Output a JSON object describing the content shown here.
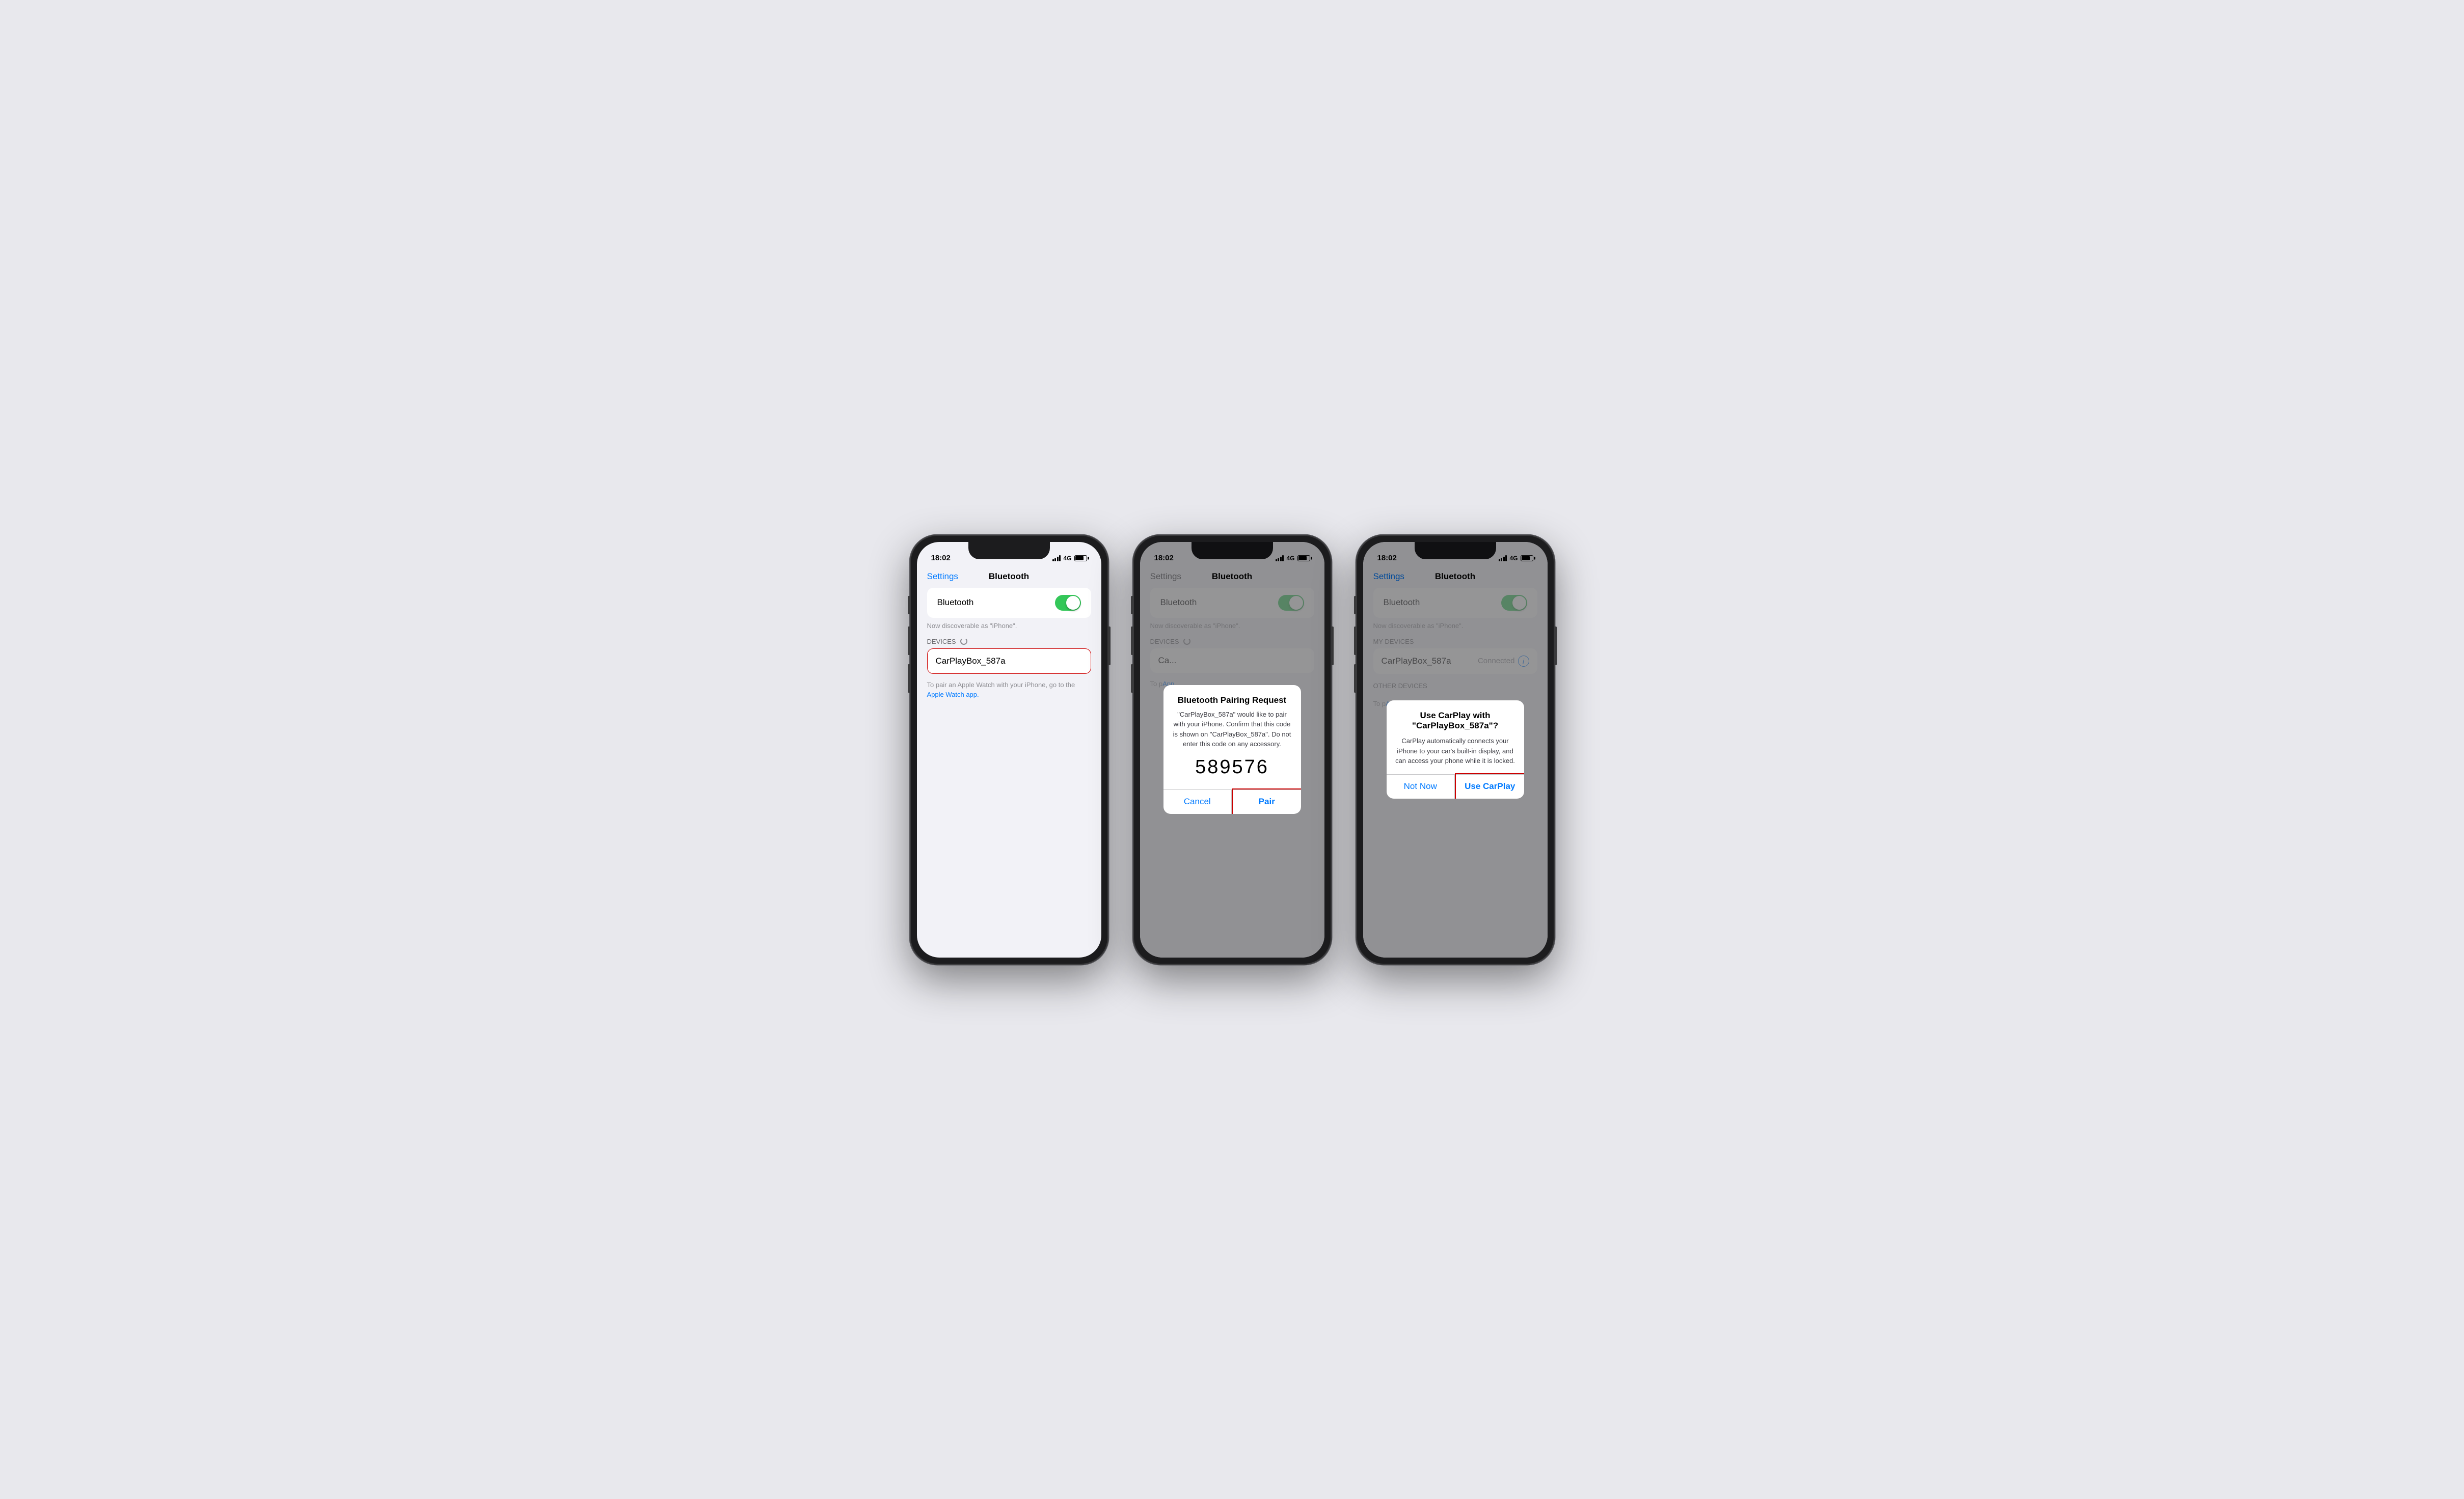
{
  "background_color": "#e8e8ed",
  "phones": [
    {
      "id": "phone1",
      "status_time": "18:02",
      "status_signal": "4G",
      "nav_back": "Settings",
      "nav_title": "Bluetooth",
      "bluetooth_label": "Bluetooth",
      "bluetooth_on": true,
      "discoverable_text": "Now discoverable as \"iPhone\".",
      "devices_section": "DEVICES",
      "device_name": "CarPlayBox_587a",
      "device_highlighted": true,
      "device_spinning": true,
      "footer_text": "To pair an Apple Watch with your iPhone, go to the ",
      "footer_link": "Apple Watch app.",
      "has_overlay": false
    },
    {
      "id": "phone2",
      "status_time": "18:02",
      "status_signal": "4G",
      "nav_back": "Settings",
      "nav_title": "Bluetooth",
      "nav_back_dimmed": true,
      "bluetooth_label": "Bluetooth",
      "bluetooth_on": true,
      "discoverable_text": "Now discoverable as \"iPhone\".",
      "devices_section": "DEVICES",
      "device_name": "Ca...",
      "device_spinning": true,
      "footer_text": "To p",
      "footer_link": "App",
      "has_overlay": true,
      "overlay_type": "pairing",
      "dialog_title": "Bluetooth Pairing Request",
      "dialog_message": "\"CarPlayBox_587a\" would like to pair with your iPhone. Confirm that this code is shown on \"CarPlayBox_587a\". Do not enter this code on any accessory.",
      "dialog_code": "589576",
      "btn_cancel": "Cancel",
      "btn_pair": "Pair"
    },
    {
      "id": "phone3",
      "status_time": "18:02",
      "status_signal": "4G",
      "nav_back": "Settings",
      "nav_title": "Bluetooth",
      "bluetooth_label": "Bluetooth",
      "bluetooth_on": true,
      "discoverable_text": "Now discoverable as \"iPhone\".",
      "my_devices_section": "MY DEVICES",
      "device_name": "CarPlayBox_587a",
      "device_status": "Connected",
      "other_devices_section": "OTHER DEVICES",
      "footer_text": "To p",
      "footer_link": "App",
      "has_overlay": true,
      "overlay_type": "carplay",
      "dialog_title": "Use CarPlay with\n\"CarPlayBox_587a\"?",
      "dialog_message": "CarPlay automatically connects your iPhone to your car's built-in display, and can access your phone while it is locked.",
      "btn_not_now": "Not Now",
      "btn_use_carplay": "Use CarPlay"
    }
  ]
}
